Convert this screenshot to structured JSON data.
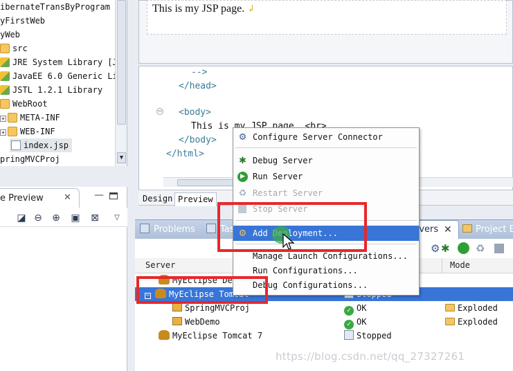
{
  "project_tree": {
    "items": [
      {
        "label": "ibernateTransByProgram",
        "icon": "project-icon"
      },
      {
        "label": "yFirstWeb",
        "icon": "project-icon"
      },
      {
        "label": "yWeb",
        "icon": "project-icon"
      },
      {
        "label": "src",
        "icon": "source-folder-icon"
      },
      {
        "label": "JRE System Library [J",
        "icon": "library-icon"
      },
      {
        "label": "JavaEE 6.0 Generic Li",
        "icon": "library-icon"
      },
      {
        "label": "JSTL 1.2.1 Library",
        "icon": "library-icon"
      },
      {
        "label": "WebRoot",
        "icon": "folder-icon"
      },
      {
        "label": "META-INF",
        "icon": "folder-icon"
      },
      {
        "label": "WEB-INF",
        "icon": "folder-icon"
      },
      {
        "label": "index.jsp",
        "icon": "jsp-file-icon"
      },
      {
        "label": "pringMVCProj",
        "icon": "project-icon"
      }
    ]
  },
  "preview_view": {
    "tab_label": "e Preview",
    "close_glyph": "✕"
  },
  "editor": {
    "preview_text": "This is my JSP page.",
    "code_lines": [
      "-->",
      "</head>",
      "<body>",
      "This is my JSP page. <br>",
      "</body>",
      "</html>"
    ],
    "tabs": {
      "design": "Design",
      "preview": "Preview"
    }
  },
  "views": {
    "tabs": {
      "problems": "Problems",
      "tasks": "Tas",
      "servers": "rvers",
      "project_explorer": "Project E"
    },
    "close_glyph": "✕"
  },
  "servers_table": {
    "headers": {
      "server": "Server",
      "mode": "Mode"
    },
    "rows": [
      {
        "server": "MyEclipse Der",
        "state": "",
        "mode": ""
      },
      {
        "server": "MyEclipse Tomcat",
        "state": "Stopped",
        "mode": "",
        "selected": true
      },
      {
        "server": "SpringMVCProj",
        "state": "OK",
        "mode": "Exploded"
      },
      {
        "server": "WebDemo",
        "state": "OK",
        "mode": "Exploded"
      },
      {
        "server": "MyEclipse Tomcat 7",
        "state": "Stopped",
        "mode": ""
      }
    ]
  },
  "context_menu": {
    "items": [
      {
        "label": "Configure Server Connector",
        "icon": "configure-icon",
        "enabled": true
      },
      {
        "label": "Debug Server",
        "icon": "bug-icon",
        "enabled": true
      },
      {
        "label": "Run Server",
        "icon": "run-icon",
        "enabled": true
      },
      {
        "label": "Restart Server",
        "icon": "restart-icon",
        "enabled": false
      },
      {
        "label": "Stop Server",
        "icon": "stop-icon",
        "enabled": false
      },
      {
        "label": "Add Deployment...",
        "icon": "add-deployment-icon",
        "enabled": true,
        "highlighted": true
      },
      {
        "label": "Manage Launch Configurations...",
        "icon": "",
        "enabled": true
      },
      {
        "label": "Run Configurations...",
        "icon": "",
        "enabled": true
      },
      {
        "label": "Debug Configurations...",
        "icon": "",
        "enabled": true
      }
    ]
  },
  "watermark": "https://blog.csdn.net/qq_27327261",
  "colors": {
    "selection": "#3875d7",
    "annotation_red": "#e8272b",
    "ok_green": "#3aa843"
  }
}
